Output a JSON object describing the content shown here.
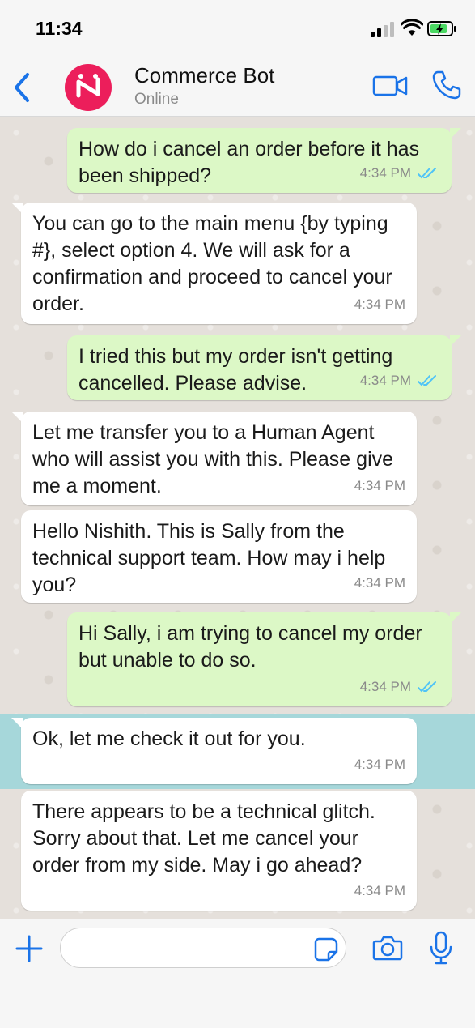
{
  "status_bar": {
    "time": "11:34"
  },
  "header": {
    "contact_name": "Commerce Bot",
    "contact_status": "Online",
    "accent_color": "#1a73e8",
    "avatar_color": "#ec1e5b"
  },
  "messages": [
    {
      "direction": "out",
      "text": "How do i cancel an order before it has been shipped?",
      "time": "4:34 PM",
      "read": true
    },
    {
      "direction": "in",
      "text": "You can go to the main menu {by typing #}, select option 4. We will ask for a confirmation and proceed to cancel your order.",
      "time": "4:34 PM"
    },
    {
      "direction": "out",
      "text": "I tried this but my order isn't getting cancelled. Please advise.",
      "time": "4:34 PM",
      "read": true
    },
    {
      "direction": "in",
      "text": "Let me transfer you to a Human Agent who will assist you with this. Please give me a moment.",
      "time": "4:34 PM"
    },
    {
      "direction": "in",
      "text": "Hello Nishith. This is Sally from the technical support team. How may i help you?",
      "time": "4:34 PM"
    },
    {
      "direction": "out",
      "text": "Hi Sally, i am trying to cancel my order but unable to do so.",
      "time": "4:34 PM",
      "read": true
    },
    {
      "direction": "in",
      "text": "Ok, let me check it out for you.",
      "time": "4:34 PM"
    },
    {
      "direction": "in",
      "text": "There appears to be a technical glitch. Sorry about that. Let me cancel your order from my side. May i go ahead?",
      "time": "4:34 PM"
    }
  ],
  "input": {
    "value": "",
    "placeholder": ""
  }
}
